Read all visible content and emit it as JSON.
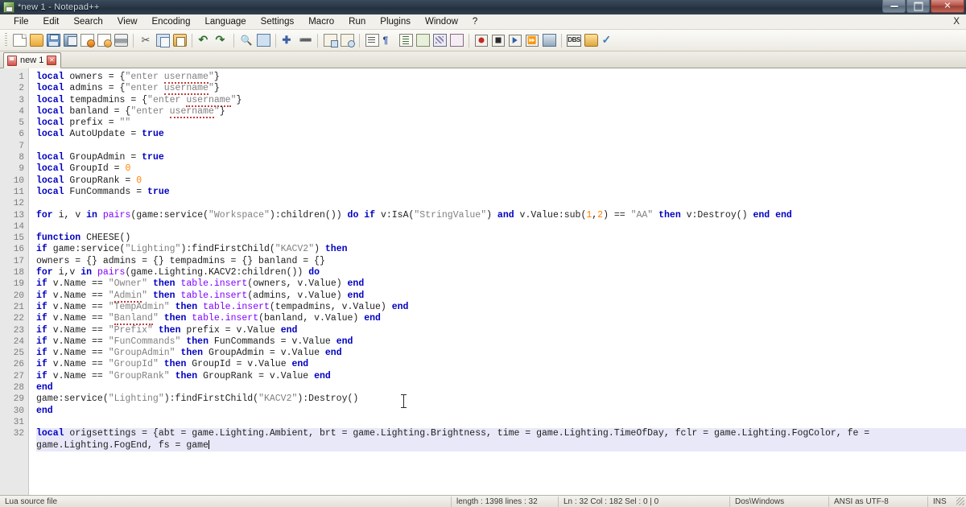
{
  "window": {
    "title": "*new 1 - Notepad++",
    "app_icon": "notepadpp-icon",
    "controls": {
      "minimize": "minimize-button",
      "maximize": "maximize-button",
      "close": "✕"
    }
  },
  "menu": {
    "items": [
      "File",
      "Edit",
      "Search",
      "View",
      "Encoding",
      "Language",
      "Settings",
      "Macro",
      "Run",
      "Plugins",
      "Window",
      "?"
    ],
    "close_doc": "X"
  },
  "toolbar": {
    "icons": [
      "new-file-icon",
      "open-file-icon",
      "save-icon",
      "save-all-icon",
      "close-file-icon",
      "close-all-files-icon",
      "print-icon",
      "cut-icon",
      "copy-icon",
      "paste-icon",
      "undo-icon",
      "redo-icon",
      "find-icon",
      "replace-icon",
      "zoom-in-icon",
      "zoom-out-icon",
      "sync-vertical-scroll-icon",
      "sync-horizontal-scroll-icon",
      "word-wrap-icon",
      "show-all-chars-icon",
      "indent-guide-icon",
      "user-defined-dialog-icon",
      "show-doc-map-icon",
      "function-list-icon",
      "start-record-macro-icon",
      "stop-record-macro-icon",
      "play-macro-icon",
      "run-macro-multiple-icon",
      "save-macro-icon",
      "dbgp-icon",
      "open-folder-icon",
      "spell-check-icon"
    ]
  },
  "tab": {
    "label": "new 1",
    "icon": "unsaved-file-icon",
    "close": "✕"
  },
  "editor": {
    "language": "Lua",
    "first_line": 1,
    "active_line": 32,
    "lines": [
      {
        "n": 1,
        "html": "<span class=\"kw\">local</span> owners = {<span class=\"str\">\"enter <span class=\"spell\">username</span>\"</span>}"
      },
      {
        "n": 2,
        "html": "<span class=\"kw\">local</span> admins = {<span class=\"str\">\"enter <span class=\"spell\">username</span>\"</span>}"
      },
      {
        "n": 3,
        "html": "<span class=\"kw\">local</span> tempadmins = {<span class=\"str\">\"enter <span class=\"spell\">username</span>\"</span>}"
      },
      {
        "n": 4,
        "html": "<span class=\"kw\">local</span> banland = {<span class=\"str\">\"enter <span class=\"spell\">username</span>\"</span>}"
      },
      {
        "n": 5,
        "html": "<span class=\"kw\">local</span> prefix = <span class=\"str\">\"\"</span>"
      },
      {
        "n": 6,
        "html": "<span class=\"kw\">local</span> AutoUpdate = <span class=\"kw\">true</span>"
      },
      {
        "n": 7,
        "html": ""
      },
      {
        "n": 8,
        "html": "<span class=\"kw\">local</span> GroupAdmin = <span class=\"kw\">true</span>"
      },
      {
        "n": 9,
        "html": "<span class=\"kw\">local</span> GroupId = <span class=\"num\">0</span>"
      },
      {
        "n": 10,
        "html": "<span class=\"kw\">local</span> GroupRank = <span class=\"num\">0</span>"
      },
      {
        "n": 11,
        "html": "<span class=\"kw\">local</span> FunCommands = <span class=\"kw\">true</span>"
      },
      {
        "n": 12,
        "html": ""
      },
      {
        "n": 13,
        "html": "<span class=\"kw\">for</span> i, v <span class=\"kw\">in</span> <span class=\"fn\">pairs</span>(game:service(<span class=\"str\">\"Workspace\"</span>):children()) <span class=\"kw\">do</span> <span class=\"kw\">if</span> v:IsA(<span class=\"str\">\"StringValue\"</span>) <span class=\"kw\">and</span> v.Value:sub(<span class=\"num\">1</span>,<span class=\"num\">2</span>) == <span class=\"str\">\"AA\"</span> <span class=\"kw\">then</span> v:Destroy() <span class=\"kw\">end</span> <span class=\"kw\">end</span>"
      },
      {
        "n": 14,
        "html": ""
      },
      {
        "n": 15,
        "html": "<span class=\"kw\">function</span> CHEESE()"
      },
      {
        "n": 16,
        "html": "<span class=\"kw\">if</span> game:service(<span class=\"str\">\"Lighting\"</span>):findFirstChild(<span class=\"str\">\"KACV2\"</span>) <span class=\"kw\">then</span>"
      },
      {
        "n": 17,
        "html": "owners = {} admins = {} tempadmins = {} banland = {}"
      },
      {
        "n": 18,
        "html": "<span class=\"kw\">for</span> i,v <span class=\"kw\">in</span> <span class=\"fn\">pairs</span>(game.Lighting.KACV2:children()) <span class=\"kw\">do</span>"
      },
      {
        "n": 19,
        "html": "<span class=\"kw\">if</span> v.Name == <span class=\"str\">\"Owner\"</span> <span class=\"kw\">then</span> <span class=\"fn\">table.insert</span>(owners, v.Value) <span class=\"kw\">end</span>"
      },
      {
        "n": 20,
        "html": "<span class=\"kw\">if</span> v.Name == <span class=\"str\">\"<span class=\"spell\">Admin</span>\"</span> <span class=\"kw\">then</span> <span class=\"fn\">table.insert</span>(admins, v.Value) <span class=\"kw\">end</span>"
      },
      {
        "n": 21,
        "html": "<span class=\"kw\">if</span> v.Name == <span class=\"str\">\"TempAdmin\"</span> <span class=\"kw\">then</span> <span class=\"fn\">table.insert</span>(tempadmins, v.Value) <span class=\"kw\">end</span>"
      },
      {
        "n": 22,
        "html": "<span class=\"kw\">if</span> v.Name == <span class=\"str\">\"<span class=\"spell\">Banland</span>\"</span> <span class=\"kw\">then</span> <span class=\"fn\">table.insert</span>(banland, v.Value) <span class=\"kw\">end</span>"
      },
      {
        "n": 23,
        "html": "<span class=\"kw\">if</span> v.Name == <span class=\"str\">\"Prefix\"</span> <span class=\"kw\">then</span> prefix = v.Value <span class=\"kw\">end</span>"
      },
      {
        "n": 24,
        "html": "<span class=\"kw\">if</span> v.Name == <span class=\"str\">\"FunCommands\"</span> <span class=\"kw\">then</span> FunCommands = v.Value <span class=\"kw\">end</span>"
      },
      {
        "n": 25,
        "html": "<span class=\"kw\">if</span> v.Name == <span class=\"str\">\"GroupAdmin\"</span> <span class=\"kw\">then</span> GroupAdmin = v.Value <span class=\"kw\">end</span>"
      },
      {
        "n": 26,
        "html": "<span class=\"kw\">if</span> v.Name == <span class=\"str\">\"GroupId\"</span> <span class=\"kw\">then</span> GroupId = v.Value <span class=\"kw\">end</span>"
      },
      {
        "n": 27,
        "html": "<span class=\"kw\">if</span> v.Name == <span class=\"str\">\"GroupRank\"</span> <span class=\"kw\">then</span> GroupRank = v.Value <span class=\"kw\">end</span>"
      },
      {
        "n": 28,
        "html": "<span class=\"kw\">end</span>"
      },
      {
        "n": 29,
        "html": "game:service(<span class=\"str\">\"Lighting\"</span>):findFirstChild(<span class=\"str\">\"KACV2\"</span>):Destroy()"
      },
      {
        "n": 30,
        "html": "<span class=\"kw\">end</span>"
      },
      {
        "n": 31,
        "html": ""
      },
      {
        "n": 32,
        "html": "<span class=\"kw\">local</span> origsettings = {abt = game.Lighting.Ambient, brt = game.Lighting.Brightness, time = game.Lighting.TimeOfDay, fclr = game.Lighting.FogColor, fe =",
        "highlight": true
      },
      {
        "n": "",
        "html": "game.Lighting.FogEnd, fs = game<span class=\"caret\"></span>",
        "highlight": true
      }
    ]
  },
  "statusbar": {
    "doc_type": "Lua source file",
    "length_lines": "length : 1398    lines : 32",
    "position": "Ln : 32    Col : 182    Sel : 0 | 0",
    "eol": "Dos\\Windows",
    "encoding": "ANSI as UTF-8",
    "insert_mode": "INS"
  },
  "colors": {
    "keyword": "#0000c0",
    "string": "#808080",
    "number": "#ff8000",
    "function": "#8000ff",
    "current_line_highlight": "#e8e8f8",
    "titlebar": "#2d3b4a"
  }
}
